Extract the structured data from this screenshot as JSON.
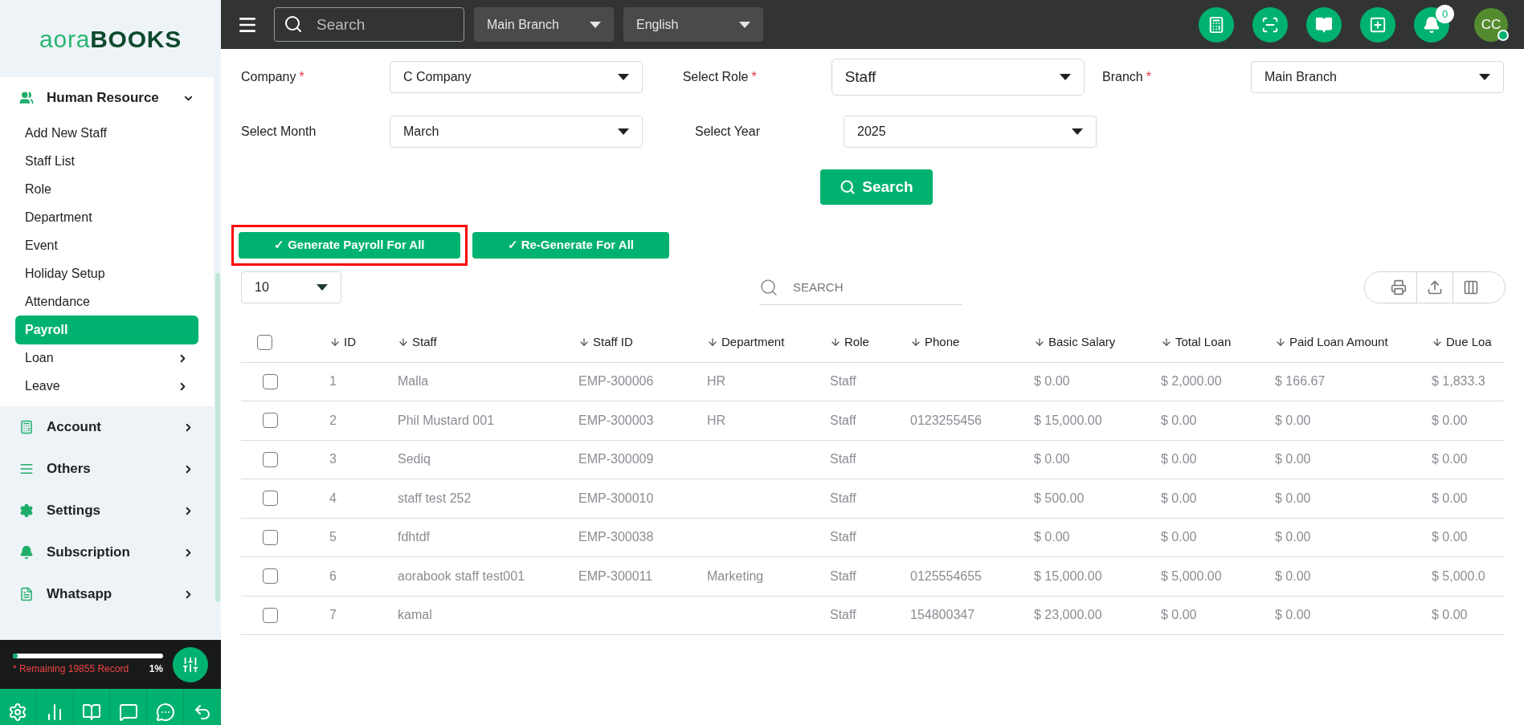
{
  "sidebar": {
    "logo": {
      "light": "aora",
      "dark": "BOOKS"
    },
    "groups": [
      {
        "label": "Human Resource",
        "expanded": true,
        "children": [
          {
            "label": "Add New Staff",
            "selected": false,
            "kind": "link"
          },
          {
            "label": "Staff List",
            "selected": false,
            "kind": "link"
          },
          {
            "label": "Role",
            "selected": false,
            "kind": "link"
          },
          {
            "label": "Department",
            "selected": false,
            "kind": "link"
          },
          {
            "label": "Event",
            "selected": false,
            "kind": "link"
          },
          {
            "label": "Holiday Setup",
            "selected": false,
            "kind": "link"
          },
          {
            "label": "Attendance",
            "selected": false,
            "kind": "link"
          },
          {
            "label": "Payroll",
            "selected": true,
            "kind": "link"
          },
          {
            "label": "Loan",
            "selected": false,
            "kind": "submenu"
          },
          {
            "label": "Leave",
            "selected": false,
            "kind": "submenu"
          }
        ]
      },
      {
        "label": "Account",
        "expanded": false
      },
      {
        "label": "Others",
        "expanded": false
      },
      {
        "label": "Settings",
        "expanded": false
      },
      {
        "label": "Subscription",
        "expanded": false
      },
      {
        "label": "Whatsapp",
        "expanded": false
      }
    ],
    "usage": {
      "level": 0.03,
      "text": "* Remaining 19855 Record",
      "percent": "1%"
    }
  },
  "topbar": {
    "search": {
      "placeholder": "Search"
    },
    "branch": "Main Branch",
    "language": "English",
    "notifications": "0",
    "avatar": "CC"
  },
  "filters": [
    {
      "label": "Company",
      "required_mark": "*",
      "value": "C Company"
    },
    {
      "label": "Select Role",
      "required_mark": "*",
      "value": "Staff"
    },
    {
      "label": "Branch",
      "required_mark": "*",
      "value": "Main Branch"
    },
    {
      "label": "Select Month",
      "value": "March"
    },
    {
      "label": "Select Year",
      "value": "2025"
    }
  ],
  "search_button": "Search",
  "actions": [
    {
      "label": "✓ Generate Payroll For All",
      "highlighted": true
    },
    {
      "label": "✓ Re-Generate For All",
      "highlighted": false
    }
  ],
  "table_tools": {
    "page_size": "10",
    "search": {
      "placeholder": "SEARCH"
    }
  },
  "table": {
    "select_all": {
      "checked": false
    },
    "columns": [
      "ID",
      "Staff",
      "Staff ID",
      "Department",
      "Role",
      "Phone",
      "Basic Salary",
      "Total Loan",
      "Paid Loan Amount",
      "Due Loa"
    ],
    "rows": [
      {
        "checked": false,
        "cells": [
          "1",
          "Malla",
          "EMP-300006",
          "HR",
          "Staff",
          "",
          "$ 0.00",
          "$ 2,000.00",
          "$ 166.67",
          "$ 1,833.3"
        ]
      },
      {
        "checked": false,
        "cells": [
          "2",
          "Phil Mustard 001",
          "EMP-300003",
          "HR",
          "Staff",
          "0123255456",
          "$ 15,000.00",
          "$ 0.00",
          "$ 0.00",
          "$ 0.00"
        ]
      },
      {
        "checked": false,
        "cells": [
          "3",
          "Sediq",
          "EMP-300009",
          "",
          "Staff",
          "",
          "$ 0.00",
          "$ 0.00",
          "$ 0.00",
          "$ 0.00"
        ]
      },
      {
        "checked": false,
        "cells": [
          "4",
          "staff test 252",
          "EMP-300010",
          "",
          "Staff",
          "",
          "$ 500.00",
          "$ 0.00",
          "$ 0.00",
          "$ 0.00"
        ]
      },
      {
        "checked": false,
        "cells": [
          "5",
          "fdhtdf",
          "EMP-300038",
          "",
          "Staff",
          "",
          "$ 0.00",
          "$ 0.00",
          "$ 0.00",
          "$ 0.00"
        ]
      },
      {
        "checked": false,
        "cells": [
          "6",
          "aorabook staff test001",
          "EMP-300011",
          "Marketing",
          "Staff",
          "0125554655",
          "$ 15,000.00",
          "$ 5,000.00",
          "$ 0.00",
          "$ 5,000.0"
        ]
      },
      {
        "checked": false,
        "cells": [
          "7",
          "kamal",
          "",
          "",
          "Staff",
          "154800347",
          "$ 23,000.00",
          "$ 0.00",
          "$ 0.00",
          "$ 0.00"
        ]
      }
    ]
  }
}
